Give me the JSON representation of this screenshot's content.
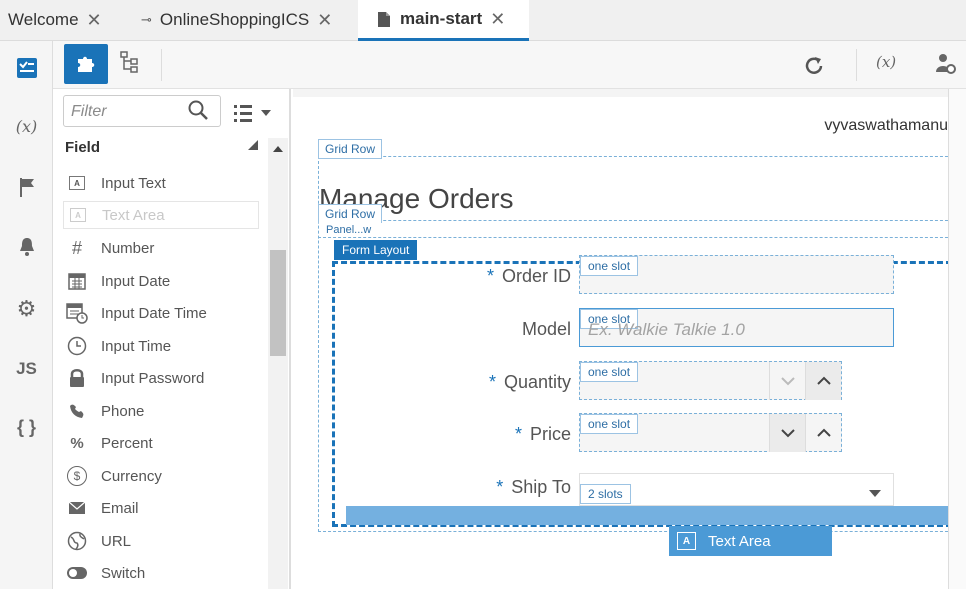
{
  "tabs": [
    {
      "label": "Welcome",
      "active": false
    },
    {
      "label": "OnlineShoppingICS",
      "active": false
    },
    {
      "label": "main-start",
      "active": true
    }
  ],
  "rail_icons": [
    "checklist-icon",
    "variable-icon",
    "flag-icon",
    "bell-icon",
    "gear-icon",
    "js-icon",
    "braces-icon"
  ],
  "rail_text": {
    "variable": "(x)",
    "js": "JS",
    "braces": "{ }"
  },
  "palette": {
    "filter_placeholder": "Filter",
    "section_title": "Field",
    "items": [
      {
        "label": "Input Text",
        "icon": "text-box-icon"
      },
      {
        "label": "Text Area",
        "icon": "text-box-icon"
      },
      {
        "label": "Number",
        "icon": "hash-icon"
      },
      {
        "label": "Input Date",
        "icon": "calendar-icon"
      },
      {
        "label": "Input Date Time",
        "icon": "calendar-clock-icon"
      },
      {
        "label": "Input Time",
        "icon": "clock-icon"
      },
      {
        "label": "Input Password",
        "icon": "lock-icon"
      },
      {
        "label": "Phone",
        "icon": "phone-icon"
      },
      {
        "label": "Percent",
        "icon": "percent-icon"
      },
      {
        "label": "Currency",
        "icon": "dollar-icon"
      },
      {
        "label": "Email",
        "icon": "envelope-icon"
      },
      {
        "label": "URL",
        "icon": "globe-icon"
      },
      {
        "label": "Switch",
        "icon": "toggle-icon"
      }
    ],
    "glyphs": {
      "box": "A",
      "hash": "#",
      "percent": "%",
      "dollar": "$"
    }
  },
  "toolbar": {
    "variable_text": "(x)"
  },
  "canvas": {
    "username": "vyvaswathamanu",
    "grid_row_1": "Grid Row",
    "title": "Manage Orders",
    "grid_row_2": "Grid Row",
    "panel_tag": "Panel...w",
    "form_layout": "Form Layout",
    "fields": [
      {
        "label": "Order ID",
        "required": true,
        "slot": "one slot"
      },
      {
        "label": "Model",
        "required": false,
        "slot": "one slot",
        "placeholder": "Ex. Walkie Talkie 1.0"
      },
      {
        "label": "Quantity",
        "required": true,
        "slot": "one slot"
      },
      {
        "label": "Price",
        "required": true,
        "slot": "one slot"
      },
      {
        "label": "Ship To",
        "required": true,
        "slot": "2 slots"
      }
    ],
    "required_mark": "*",
    "drag_item": "Text Area",
    "drag_glyph": "A"
  }
}
